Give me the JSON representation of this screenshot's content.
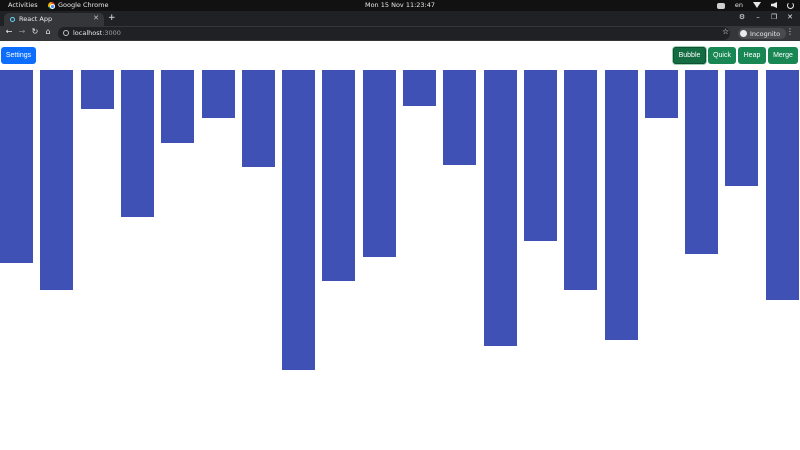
{
  "system_bar": {
    "activities": "Activities",
    "app_name": "Google Chrome",
    "clock": "Mon 15 Nov  11:23:47",
    "language": "en",
    "icons": [
      "discord-icon",
      "wifi-icon",
      "speaker-icon",
      "power-icon"
    ]
  },
  "browser": {
    "tab_title": "React App",
    "tab_close": "✕",
    "new_tab": "+",
    "url_host": "localhost",
    "url_port": ":3000",
    "profile_label": "Incognito",
    "star": "☆",
    "menu": "⋮",
    "back": "←",
    "forward": "→",
    "reload": "↻",
    "home": "⌂",
    "win_extension": "⚙",
    "win_minimize": "–",
    "win_restore": "❐",
    "win_close": "✕"
  },
  "controls": {
    "settings_label": "Settings",
    "algorithms": [
      {
        "label": "Bubble",
        "active": true
      },
      {
        "label": "Quick",
        "active": false
      },
      {
        "label": "Heap",
        "active": false
      },
      {
        "label": "Merge",
        "active": false
      }
    ]
  },
  "colors": {
    "bar": "#3f51b5",
    "primary": "#0d6efd",
    "success": "#198754"
  },
  "array_values": [
    193,
    220,
    39,
    147,
    73,
    48,
    97,
    300,
    211,
    187,
    36,
    95,
    276,
    171,
    220,
    270,
    48,
    184,
    116,
    230
  ]
}
